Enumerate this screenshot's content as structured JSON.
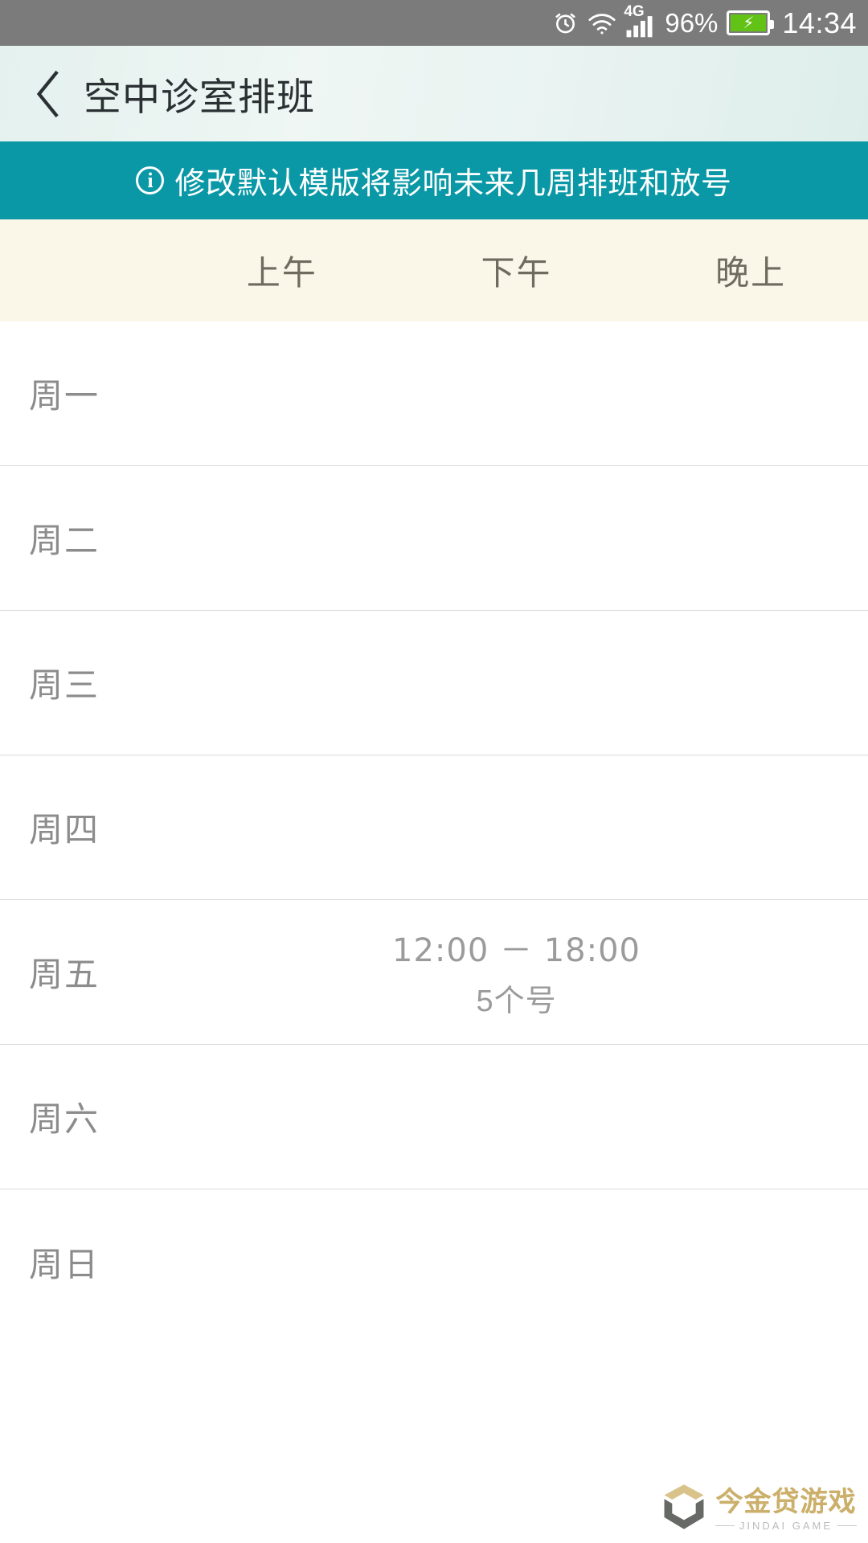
{
  "statusbar": {
    "alarm_icon": "alarm-clock-icon",
    "wifi_icon": "wifi-icon",
    "network_label": "4G",
    "signal_icon": "cellular-signal-icon",
    "battery_percent": "96%",
    "battery_icon": "battery-charging-icon",
    "time": "14:34"
  },
  "titlebar": {
    "back_icon": "back-chevron-icon",
    "title": "空中诊室排班"
  },
  "notice": {
    "icon": "info-circle-icon",
    "text": "修改默认模版将影响未来几周排班和放号"
  },
  "table": {
    "day_column_header": "",
    "slot_headers": [
      "上午",
      "下午",
      "晚上"
    ],
    "rows": [
      {
        "day": "周一",
        "cells": [
          {
            "time": "",
            "count": ""
          },
          {
            "time": "",
            "count": ""
          },
          {
            "time": "",
            "count": ""
          }
        ]
      },
      {
        "day": "周二",
        "cells": [
          {
            "time": "",
            "count": ""
          },
          {
            "time": "",
            "count": ""
          },
          {
            "time": "",
            "count": ""
          }
        ]
      },
      {
        "day": "周三",
        "cells": [
          {
            "time": "",
            "count": ""
          },
          {
            "time": "",
            "count": ""
          },
          {
            "time": "",
            "count": ""
          }
        ]
      },
      {
        "day": "周四",
        "cells": [
          {
            "time": "",
            "count": ""
          },
          {
            "time": "",
            "count": ""
          },
          {
            "time": "",
            "count": ""
          }
        ]
      },
      {
        "day": "周五",
        "cells": [
          {
            "time": "",
            "count": ""
          },
          {
            "time": "12:00 － 18:00",
            "count": "5个号"
          },
          {
            "time": "",
            "count": ""
          }
        ]
      },
      {
        "day": "周六",
        "cells": [
          {
            "time": "",
            "count": ""
          },
          {
            "time": "",
            "count": ""
          },
          {
            "time": "",
            "count": ""
          }
        ]
      },
      {
        "day": "周日",
        "cells": [
          {
            "time": "",
            "count": ""
          },
          {
            "time": "",
            "count": ""
          },
          {
            "time": "",
            "count": ""
          }
        ]
      }
    ]
  },
  "watermark": {
    "cn": "今金贷游戏",
    "en": "JINDAI GAME",
    "logo_icon": "shield-logo-icon"
  },
  "colors": {
    "statusbar_bg": "#7b7b7b",
    "titlebar_bg": "#e9f3f1",
    "notice_bg": "#0a98a6",
    "header_bg": "#faf6e8",
    "row_bg": "#ffffff",
    "divider": "#d9d9d9",
    "battery_green": "#62c216",
    "text_gray": "#8c8c8c"
  }
}
